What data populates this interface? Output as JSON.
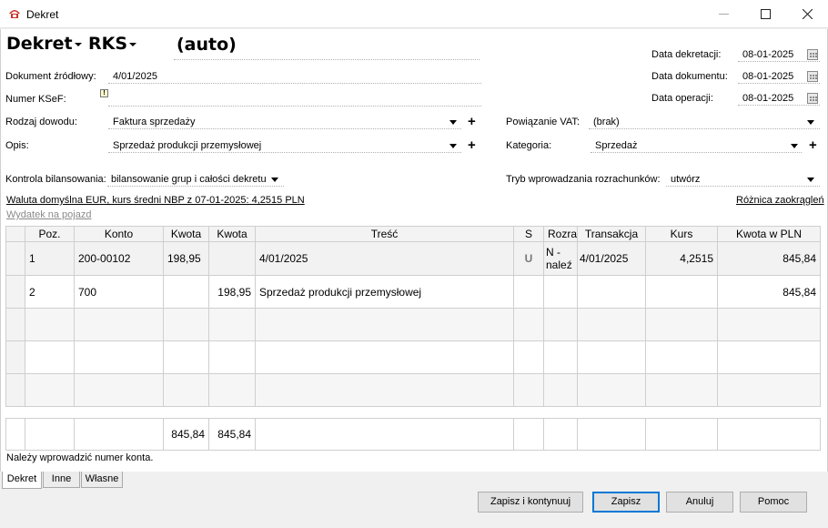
{
  "window": {
    "title": "Dekret"
  },
  "header": {
    "doc_type": "Dekret",
    "register": "RKS",
    "number": "(auto)"
  },
  "dates": {
    "dekretacji_label": "Data dekretacji:",
    "dekretacji_value": "08-01-2025",
    "dokumentu_label": "Data dokumentu:",
    "dokumentu_value": "08-01-2025",
    "operacji_label": "Data operacji:",
    "operacji_value": "08-01-2025"
  },
  "fields": {
    "dokument_label": "Dokument źródłowy:",
    "dokument_value": "4/01/2025",
    "ksef_label": "Numer KSeF:",
    "rodzaj_label": "Rodzaj dowodu:",
    "rodzaj_value": "Faktura sprzedaży",
    "opis_label": "Opis:",
    "opis_value": "Sprzedaż produkcji przemysłowej",
    "vat_label": "Powiązanie VAT:",
    "vat_value": "(brak)",
    "kategoria_label": "Kategoria:",
    "kategoria_value": "Sprzedaż",
    "kontrola_label": "Kontrola bilansowania:",
    "kontrola_value": "bilansowanie grup i całości dekretu",
    "tryb_label": "Tryb wprowadzania rozrachunków:",
    "tryb_value": "utwórz"
  },
  "links": {
    "waluta": "Waluta domyślna EUR, kurs średni NBP z 07-01-2025: 4,2515 PLN",
    "roznica": "Różnica zaokrągleń",
    "wydatek": "Wydatek na pojazd"
  },
  "table": {
    "headers": [
      "Poz.",
      "Konto",
      "Kwota",
      "Kwota",
      "Treść",
      "S",
      "Rozra",
      "Transakcja",
      "Kurs",
      "Kwota w PLN"
    ],
    "rows": [
      {
        "poz": "1",
        "konto": "200-00102",
        "kwota_wn": "198,95",
        "kwota_ma": "",
        "tresc": "4/01/2025",
        "s": "U",
        "rozra": "N - naleź",
        "transakcja": "4/01/2025",
        "kurs": "4,2515",
        "kwota_pln": "845,84"
      },
      {
        "poz": "2",
        "konto": "700",
        "kwota_wn": "",
        "kwota_ma": "198,95",
        "tresc": "Sprzedaż produkcji przemysłowej",
        "s": "",
        "rozra": "",
        "transakcja": "",
        "kurs": "",
        "kwota_pln": "845,84"
      }
    ],
    "totals": {
      "wn": "845,84",
      "ma": "845,84"
    }
  },
  "status": "Należy wprowadzić numer konta.",
  "tabs": [
    "Dekret",
    "Inne",
    "Własne"
  ],
  "buttons": {
    "save_continue": "Zapisz i kontynuuj",
    "save": "Zapisz",
    "cancel": "Anuluj",
    "help": "Pomoc"
  }
}
